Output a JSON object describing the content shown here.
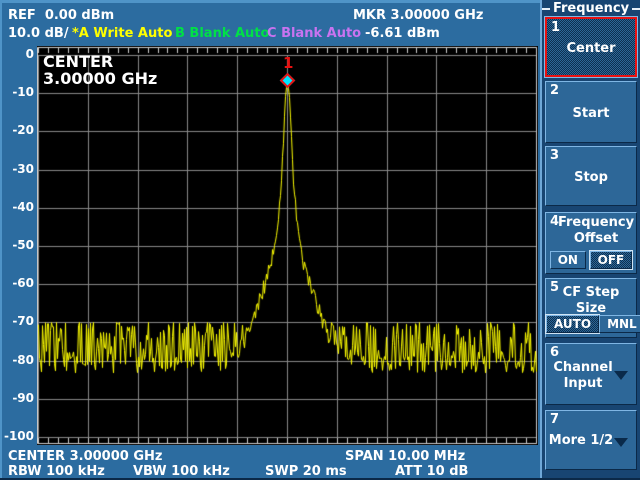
{
  "header": {
    "ref": "REF  0.00 dBm",
    "scale": "10.0 dB/",
    "trace_a": "*A Write Auto",
    "trace_b": "B Blank Auto",
    "trace_c": "C Blank Auto",
    "mkr_freq": "MKR 3.00000 GHz",
    "mkr_ampl": "-6.61 dBm"
  },
  "plot": {
    "overlay_line1": "CENTER",
    "overlay_line2": "3.00000 GHz",
    "y_ticks": [
      "0",
      "-10",
      "-20",
      "-30",
      "-40",
      "-50",
      "-60",
      "-70",
      "-80",
      "-90",
      "-100"
    ],
    "marker_label": "1"
  },
  "status": {
    "center": "CENTER 3.00000 GHz",
    "span": "SPAN 10.00 MHz",
    "rbw": "RBW 100 kHz",
    "vbw": "VBW 100 kHz",
    "swp": "SWP 20 ms",
    "att": "ATT 10 dB"
  },
  "menu": {
    "title": "Frequency",
    "buttons": [
      {
        "num": "1",
        "label": "Center",
        "selected": true
      },
      {
        "num": "2",
        "label": "Start"
      },
      {
        "num": "3",
        "label": "Stop"
      },
      {
        "num": "4",
        "label": "Frequency Offset",
        "toggle": [
          "ON",
          "OFF"
        ],
        "active": "OFF"
      },
      {
        "num": "5",
        "label": "CF Step Size",
        "toggle": [
          "AUTO",
          "MNL"
        ],
        "active": "AUTO"
      },
      {
        "num": "6",
        "label": "Channel Input",
        "arrow": true
      },
      {
        "num": "7",
        "label": "More 1/2",
        "arrow": true
      }
    ]
  },
  "colors": {
    "trace": "#ffff00",
    "trace_b_label": "#00e046",
    "trace_c_label": "#c873f0",
    "marker_fill": "#00e5ff",
    "marker_outline": "#e81010",
    "grid": "#8a8a8a",
    "plot_border": "#cfcfcf",
    "panel_blue": "#2c6ca0",
    "menu_bg": "#184572",
    "button_blue": "#2d6798",
    "selected_border": "#e81010"
  },
  "chart_data": {
    "type": "line",
    "title": "Spectrum trace A",
    "x_axis": {
      "center_GHz": 3.0,
      "span_MHz": 10.0,
      "divisions": 10,
      "start_GHz": 2.995,
      "stop_GHz": 3.005
    },
    "y_axis": {
      "label": "dBm",
      "ref_dBm": 0,
      "per_div_dB": 10,
      "min_dBm": -100,
      "max_dBm": 0,
      "divisions": 10
    },
    "rbw_kHz": 100,
    "vbw_kHz": 100,
    "sweep_ms": 20,
    "attenuation_dB": 10,
    "marker": {
      "number": 1,
      "freq_GHz": 3.0,
      "ampl_dBm": -6.61
    },
    "peak": {
      "freq_GHz": 3.0,
      "ampl_dBm": -6.61
    },
    "noise": {
      "mean_dBm": -81,
      "upper_dBm": -70,
      "lower_dBm": -96,
      "shape": 1.7,
      "depth_dB": 26
    },
    "envelope": {
      "offsets_MHz": [
        0,
        0.04,
        0.08,
        0.12,
        0.2,
        0.3,
        0.45,
        0.6,
        0.8,
        1.0,
        1.3,
        5.0
      ],
      "levels_dBm": [
        -6.61,
        -11,
        -22,
        -33,
        -45,
        -53,
        -60,
        -66,
        -73,
        -78,
        -81,
        -81
      ]
    }
  }
}
